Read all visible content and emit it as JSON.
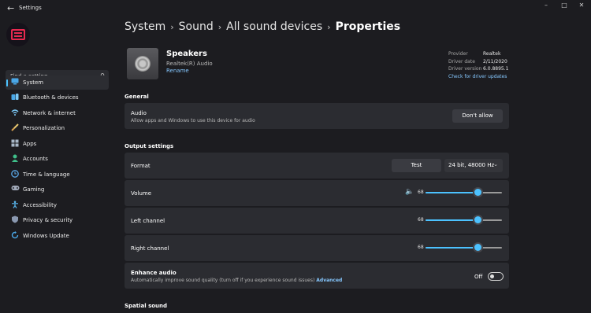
{
  "app": {
    "title": "Settings"
  },
  "search": {
    "placeholder": "Find a setting"
  },
  "sidebar": {
    "items": [
      {
        "label": "System",
        "icon": "monitor-icon",
        "active": true
      },
      {
        "label": "Bluetooth & devices",
        "icon": "bluetooth-icon"
      },
      {
        "label": "Network & internet",
        "icon": "wifi-icon"
      },
      {
        "label": "Personalization",
        "icon": "brush-icon"
      },
      {
        "label": "Apps",
        "icon": "apps-icon"
      },
      {
        "label": "Accounts",
        "icon": "person-icon"
      },
      {
        "label": "Time & language",
        "icon": "globe-clock-icon"
      },
      {
        "label": "Gaming",
        "icon": "gamepad-icon"
      },
      {
        "label": "Accessibility",
        "icon": "accessibility-icon"
      },
      {
        "label": "Privacy & security",
        "icon": "shield-icon"
      },
      {
        "label": "Windows Update",
        "icon": "update-icon"
      }
    ]
  },
  "breadcrumb": [
    "System",
    "Sound",
    "All sound devices",
    "Properties"
  ],
  "device": {
    "name": "Speakers",
    "subtitle": "Realtek(R) Audio",
    "rename_label": "Rename",
    "info": [
      {
        "key": "Provider",
        "value": "Realtek"
      },
      {
        "key": "Driver date",
        "value": "2/11/2020"
      },
      {
        "key": "Driver version",
        "value": "6.0.8895.1"
      }
    ],
    "driver_link": "Check for driver updates"
  },
  "general": {
    "title": "General",
    "audio": {
      "title": "Audio",
      "subtitle": "Allow apps and Windows to use this device for audio",
      "button": "Don't allow"
    }
  },
  "output": {
    "title": "Output settings",
    "format": {
      "label": "Format",
      "test_label": "Test",
      "selected": "24 bit, 48000 Hz"
    },
    "volume": {
      "label": "Volume",
      "value": "68",
      "level": 0.68
    },
    "left": {
      "label": "Left channel",
      "value": "68",
      "level": 0.68
    },
    "right": {
      "label": "Right channel",
      "value": "68",
      "level": 0.68
    },
    "enhance": {
      "title": "Enhance audio",
      "subtitle": "Automatically improve sound quality (turn off if you experience sound issues)",
      "link": "Advanced",
      "state": "Off"
    }
  },
  "spatial": {
    "title": "Spatial sound"
  },
  "colors": {
    "accent": "#4cc2ff",
    "background": "#1c1c20",
    "card": "#2b2c31",
    "link": "#86c8ff",
    "logo": "#e8294f"
  }
}
